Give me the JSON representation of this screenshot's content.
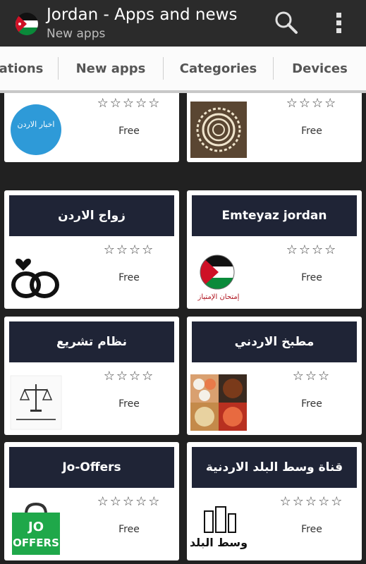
{
  "header": {
    "title": "Jordan - Apps and news",
    "subtitle": "New apps",
    "app_icon": "jordan-flag-icon",
    "search_icon": "search-icon",
    "menu_icon": "overflow-menu-icon"
  },
  "tabs": [
    {
      "label": "ations"
    },
    {
      "label": "New apps"
    },
    {
      "label": "Categories"
    },
    {
      "label": "Devices"
    }
  ],
  "colors": {
    "action_bar": "#2b2b2b",
    "card_banner": "#1f2436",
    "background": "#212121"
  },
  "apps": [
    {
      "name": "",
      "rating_stars": "☆☆☆☆☆",
      "price": "Free",
      "icon": "akhbar-alordon-logo-icon"
    },
    {
      "name": "",
      "rating_stars": "☆☆☆☆",
      "price": "Free",
      "icon": "sun-pattern-icon"
    },
    {
      "name": "زواج الاردن",
      "rating_stars": "☆☆☆☆",
      "price": "Free",
      "icon": "wedding-rings-icon"
    },
    {
      "name": "Emteyaz jordan",
      "rating_stars": "☆☆☆☆",
      "price": "Free",
      "icon": "jordan-flag-circle-icon"
    },
    {
      "name": "نظام تشريع",
      "rating_stars": "☆☆☆☆",
      "price": "Free",
      "icon": "scales-logo-icon"
    },
    {
      "name": "مطبخ الاردني",
      "rating_stars": "☆☆☆",
      "price": "Free",
      "icon": "food-photos-icon"
    },
    {
      "name": "Jo-Offers",
      "rating_stars": "☆☆☆☆☆",
      "price": "Free",
      "icon": "shopping-bag-icon"
    },
    {
      "name": "قناة وسط البلد الاردنية",
      "rating_stars": "☆☆☆☆☆",
      "price": "Free",
      "icon": "wasat-albalad-logo-icon"
    }
  ],
  "icon_text": {
    "akhbar": "اخبار الاردن",
    "jo": "JO",
    "offers": "OFFERS",
    "wasat": "وسط البلد",
    "emteyaz": "إمتحان الإمتياز"
  }
}
